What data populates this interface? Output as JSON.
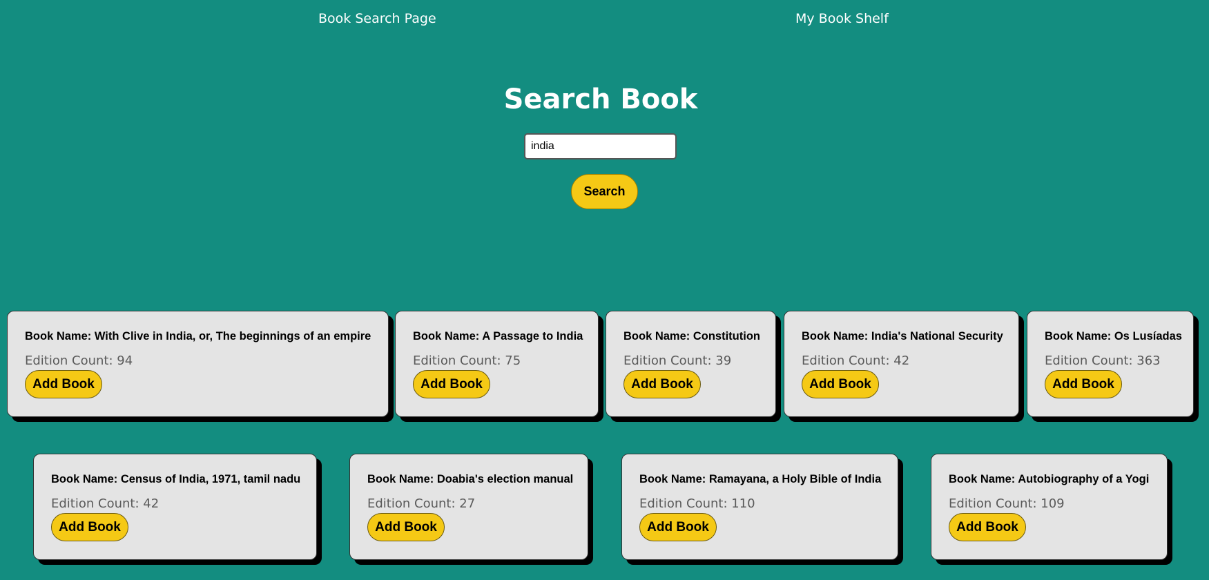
{
  "nav": {
    "search_page": "Book Search Page",
    "shelf_page": "My Book Shelf"
  },
  "search": {
    "title": "Search Book",
    "query": "india",
    "button_label": "Search"
  },
  "results": [
    {
      "name": "Book Name: With Clive in India, or, The beginnings of an empire",
      "count": "Edition Count: 94",
      "add_label": "Add Book"
    },
    {
      "name": "Book Name: A Passage to India",
      "count": "Edition Count: 75",
      "add_label": "Add Book"
    },
    {
      "name": "Book Name: Constitution",
      "count": "Edition Count: 39",
      "add_label": "Add Book"
    },
    {
      "name": "Book Name: India's National Security",
      "count": "Edition Count: 42",
      "add_label": "Add Book"
    },
    {
      "name": "Book Name: Os Lusíadas",
      "count": "Edition Count: 363",
      "add_label": "Add Book"
    },
    {
      "name": "Book Name: Census of India, 1971, tamil nadu",
      "count": "Edition Count: 42",
      "add_label": "Add Book"
    },
    {
      "name": "Book Name: Doabia's election manual",
      "count": "Edition Count: 27",
      "add_label": "Add Book"
    },
    {
      "name": "Book Name: Ramayana, a Holy Bible of India",
      "count": "Edition Count: 110",
      "add_label": "Add Book"
    },
    {
      "name": "Book Name: Autobiography of a Yogi",
      "count": "Edition Count: 109",
      "add_label": "Add Book"
    }
  ],
  "colors": {
    "background": "#138d80",
    "accent": "#f5c915",
    "card": "#e4e4e4"
  }
}
